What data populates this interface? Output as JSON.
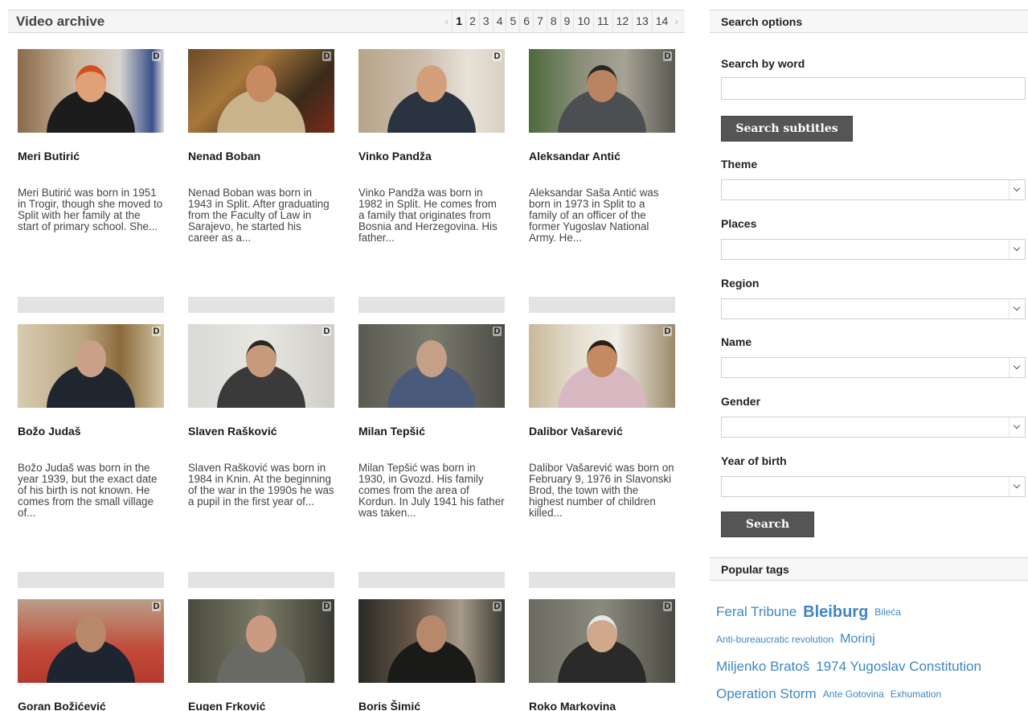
{
  "archive": {
    "title": "Video archive",
    "pager": {
      "prev": "‹",
      "next": "›",
      "pages": [
        "1",
        "2",
        "3",
        "4",
        "5",
        "6",
        "7",
        "8",
        "9",
        "10",
        "11",
        "12",
        "13",
        "14"
      ],
      "current": "1"
    }
  },
  "cards": [
    {
      "name": "Meri Butirić",
      "desc": "Meri Butirić was born in 1951 in Trogir, though she moved to Split with her family at the start of primary school. She..."
    },
    {
      "name": "Nenad Boban",
      "desc": "Nenad Boban was born in 1943 in Split. After graduating from the Faculty of Law in Sarajevo, he started his career as a..."
    },
    {
      "name": "Vinko Pandža",
      "desc": "Vinko Pandža was born in 1982 in Split. He comes from a family that originates from Bosnia and Herzegovina. His father..."
    },
    {
      "name": "Aleksandar Antić",
      "desc": "Aleksandar Saša Antić was born in 1973 in Split to a family of an officer of the former Yugoslav National Army. He..."
    },
    {
      "name": "Božo Judaš",
      "desc": "Božo Judaš was born in the year 1939, but the exact date of his birth is not known. He comes from the small village of..."
    },
    {
      "name": "Slaven Rašković",
      "desc": "Slaven Rašković was born in 1984 in Knin. At the beginning of the war in the 1990s he was a pupil in the first year of..."
    },
    {
      "name": "Milan Tepšić",
      "desc": "Milan Tepšić was born in 1930, in Gvozd. His family comes from the area of Kordun. In July 1941 his father was taken..."
    },
    {
      "name": "Dalibor Vašarević",
      "desc": "Dalibor Vašarević was born on February 9, 1976 in Slavonski Brod, the town with the highest number of children killed..."
    },
    {
      "name": "Goran Božićević",
      "desc": ""
    },
    {
      "name": "Eugen Frković",
      "desc": ""
    },
    {
      "name": "Boris Šimić",
      "desc": ""
    },
    {
      "name": "Roko Markovina",
      "desc": ""
    }
  ],
  "thumb_logo": "D",
  "search": {
    "title": "Search options",
    "word_label": "Search by word",
    "word_value": "",
    "subtitles_button": "Search subtitles",
    "filters": [
      {
        "label": "Theme",
        "value": ""
      },
      {
        "label": "Places",
        "value": ""
      },
      {
        "label": "Region",
        "value": ""
      },
      {
        "label": "Name",
        "value": ""
      },
      {
        "label": "Gender",
        "value": ""
      },
      {
        "label": "Year of birth",
        "value": ""
      }
    ],
    "search_button": "Search"
  },
  "tags": {
    "title": "Popular tags",
    "items": [
      "Feral Tribune",
      "Bleiburg",
      "Bileća",
      "Anti-bureaucratic revolution",
      "Morinj",
      "Miljenko Bratoš",
      "1974 Yugoslav Constitution",
      "Operation Storm",
      "Ante Gotovina",
      "Exhumation"
    ]
  },
  "colors": {
    "tag_link": "#3e87c4",
    "button_bg": "#555555",
    "placeholder_bar": "#e3e3e3"
  }
}
